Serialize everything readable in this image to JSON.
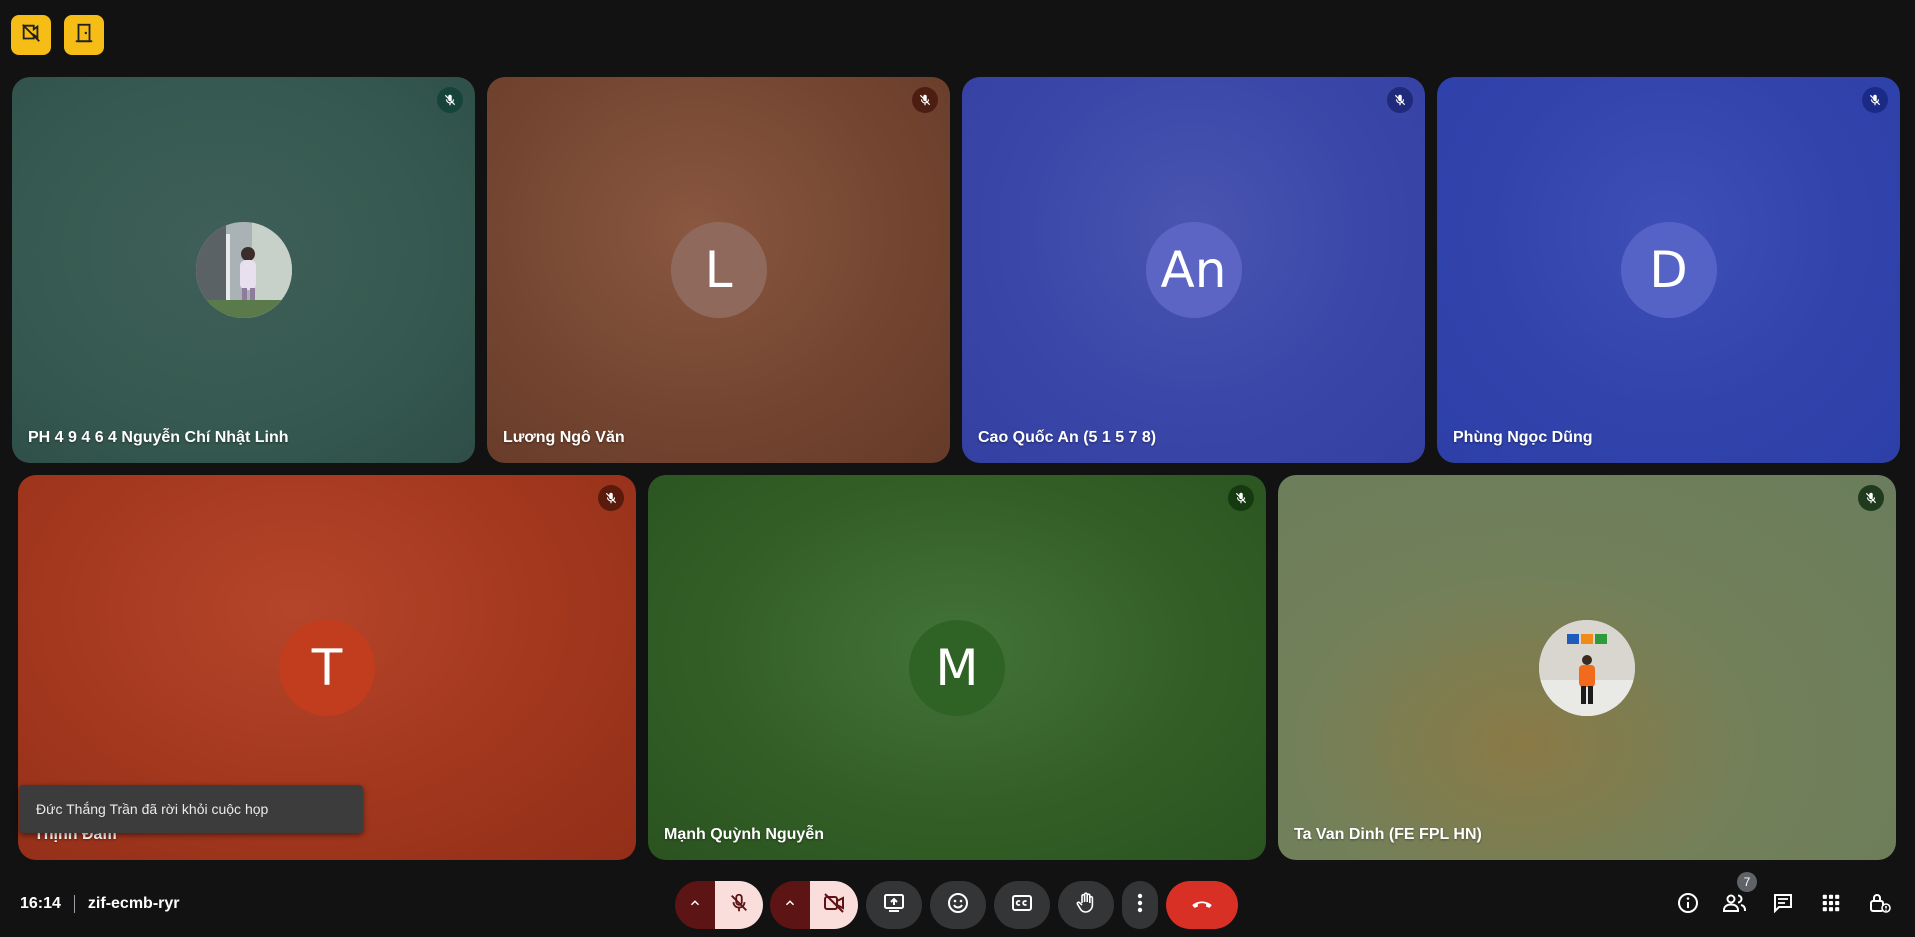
{
  "top_buttons": [
    {
      "icon": "no-video-file-icon"
    },
    {
      "icon": "door-exit-icon"
    }
  ],
  "participants": [
    {
      "name": "PH 4 9 4 6 4 Nguyễn Chí Nhật Linh",
      "initial": "",
      "has_photo": true,
      "mic": "muted"
    },
    {
      "name": "Lương Ngô Văn",
      "initial": "L",
      "has_photo": false,
      "mic": "muted"
    },
    {
      "name": "Cao Quốc An (5 1 5 7 8)",
      "initial": "An",
      "has_photo": false,
      "mic": "muted"
    },
    {
      "name": "Phùng Ngọc Dũng",
      "initial": "D",
      "has_photo": false,
      "mic": "muted"
    },
    {
      "name": "Thịnh Đàm",
      "initial": "T",
      "has_photo": false,
      "mic": "muted"
    },
    {
      "name": "Mạnh Quỳnh Nguyễn",
      "initial": "M",
      "has_photo": false,
      "mic": "muted"
    },
    {
      "name": "Ta Van Dinh (FE FPL HN)",
      "initial": "",
      "has_photo": true,
      "mic": "muted"
    }
  ],
  "toast": {
    "text": "Đức Thắng Trần đã rời khỏi cuộc họp"
  },
  "meeting": {
    "time": "16:14",
    "code": "zif-ecmb-ryr"
  },
  "controls": {
    "mic": "muted",
    "camera": "off",
    "buttons": [
      "present-screen-icon",
      "emoji-icon",
      "captions-icon",
      "raise-hand-icon",
      "more-options-icon",
      "end-call-icon"
    ]
  },
  "right_panel": {
    "people_count": "7",
    "icons": [
      "info-icon",
      "people-icon",
      "chat-icon",
      "activities-icon",
      "host-controls-icon"
    ]
  },
  "colors": {
    "background": "#121212",
    "top_button": "#f6bd16",
    "end_call": "#d93025",
    "muted_light": "#f9dedc",
    "muted_dark": "#5c1414"
  }
}
